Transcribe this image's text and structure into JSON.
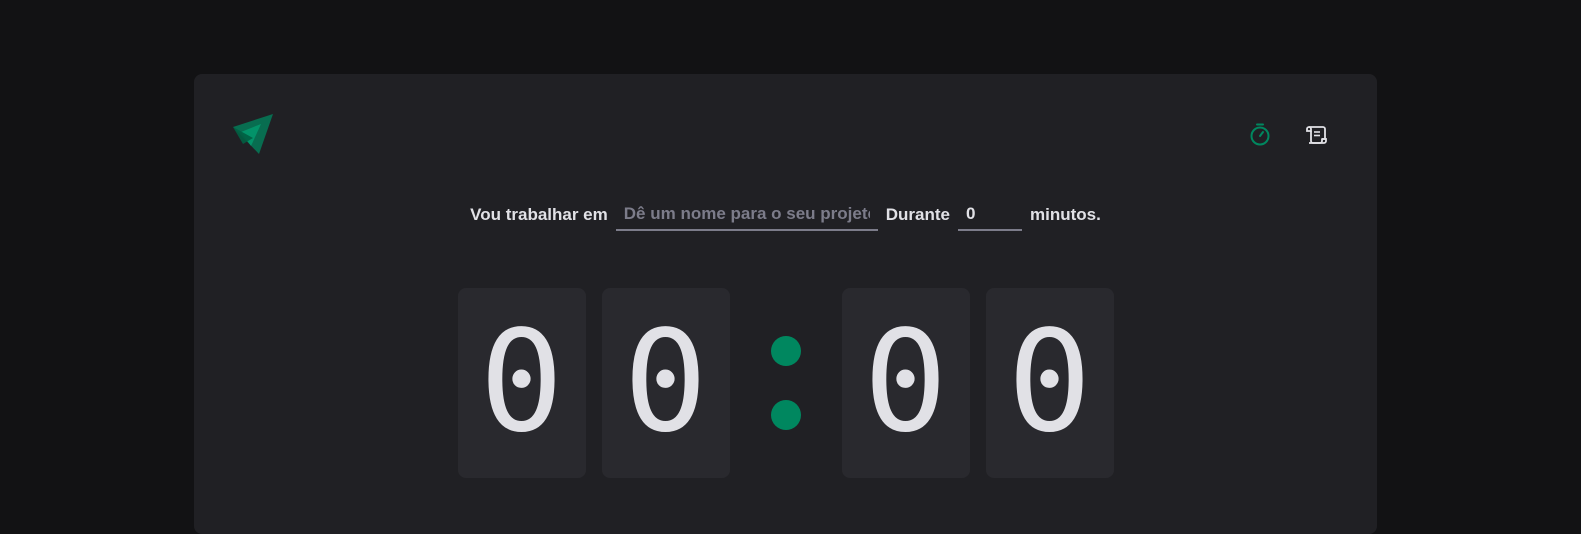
{
  "header": {
    "nav": [
      {
        "name": "timer",
        "icon": "timer-icon",
        "active": true
      },
      {
        "name": "history",
        "icon": "scroll-icon",
        "active": false
      }
    ]
  },
  "form": {
    "task_label": "Vou trabalhar em",
    "task_placeholder": "Dê um nome para o seu projeto",
    "task_value": "",
    "duration_label": "Durante",
    "minutes_value": "0",
    "minutes_suffix": "minutos."
  },
  "countdown": {
    "min_tens": "0",
    "min_ones": "0",
    "sec_tens": "0",
    "sec_ones": "0"
  },
  "colors": {
    "background": "#121214",
    "card": "#202024",
    "digit_bg": "#29292e",
    "text": "#e1e1e6",
    "accent": "#00875f"
  }
}
